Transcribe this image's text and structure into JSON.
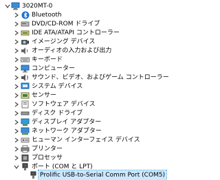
{
  "tree": {
    "root": {
      "label": "3020MT-0",
      "icon": "computer-icon",
      "expanded": true
    },
    "categories": [
      {
        "label": "Bluetooth",
        "icon": "bluetooth-icon",
        "expanded": false
      },
      {
        "label": "DVD/CD-ROM ドライブ",
        "icon": "dvd-drive-icon",
        "expanded": false
      },
      {
        "label": "IDE ATA/ATAPI コントローラー",
        "icon": "ide-controller-icon",
        "expanded": false
      },
      {
        "label": "イメージング デバイス",
        "icon": "camera-icon",
        "expanded": false
      },
      {
        "label": "オーディオの入力および出力",
        "icon": "speaker-icon",
        "expanded": false
      },
      {
        "label": "キーボード",
        "icon": "keyboard-icon",
        "expanded": false
      },
      {
        "label": "コンピューター",
        "icon": "monitor-icon",
        "expanded": false
      },
      {
        "label": "サウンド、ビデオ、およびゲーム コントローラー",
        "icon": "sound-icon",
        "expanded": false
      },
      {
        "label": "システム デバイス",
        "icon": "system-device-icon",
        "expanded": false
      },
      {
        "label": "センサー",
        "icon": "sensor-icon",
        "expanded": false
      },
      {
        "label": "ソフトウェア デバイス",
        "icon": "software-device-icon",
        "expanded": false
      },
      {
        "label": "ディスク ドライブ",
        "icon": "disk-drive-icon",
        "expanded": false
      },
      {
        "label": "ディスプレイ アダプター",
        "icon": "display-adapter-icon",
        "expanded": false
      },
      {
        "label": "ネットワーク アダプター",
        "icon": "network-adapter-icon",
        "expanded": false
      },
      {
        "label": "ヒューマン インターフェイス デバイス",
        "icon": "hid-icon",
        "expanded": false
      },
      {
        "label": "プリンター",
        "icon": "printer-icon",
        "expanded": false
      },
      {
        "label": "プロセッサ",
        "icon": "processor-icon",
        "expanded": false
      },
      {
        "label": "ポート (COM と LPT)",
        "icon": "port-icon",
        "expanded": true
      }
    ],
    "children": [
      {
        "label": "Prolific USB-to-Serial Comm Port (COM5)",
        "icon": "port-device-icon",
        "selected": true
      }
    ]
  },
  "colors": {
    "background": "#ffffff",
    "selection": "#cce8ff",
    "selection_border": "#26a0da",
    "arrow": "#444444"
  }
}
